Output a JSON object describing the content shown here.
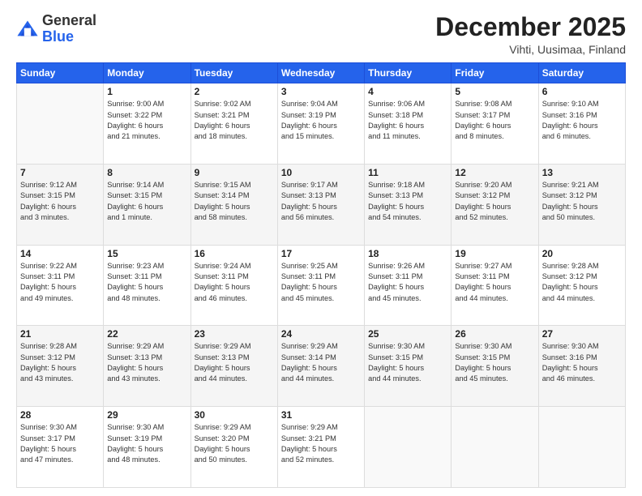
{
  "header": {
    "logo_general": "General",
    "logo_blue": "Blue",
    "month": "December 2025",
    "location": "Vihti, Uusimaa, Finland"
  },
  "days_of_week": [
    "Sunday",
    "Monday",
    "Tuesday",
    "Wednesday",
    "Thursday",
    "Friday",
    "Saturday"
  ],
  "weeks": [
    [
      {
        "day": "",
        "info": ""
      },
      {
        "day": "1",
        "info": "Sunrise: 9:00 AM\nSunset: 3:22 PM\nDaylight: 6 hours\nand 21 minutes."
      },
      {
        "day": "2",
        "info": "Sunrise: 9:02 AM\nSunset: 3:21 PM\nDaylight: 6 hours\nand 18 minutes."
      },
      {
        "day": "3",
        "info": "Sunrise: 9:04 AM\nSunset: 3:19 PM\nDaylight: 6 hours\nand 15 minutes."
      },
      {
        "day": "4",
        "info": "Sunrise: 9:06 AM\nSunset: 3:18 PM\nDaylight: 6 hours\nand 11 minutes."
      },
      {
        "day": "5",
        "info": "Sunrise: 9:08 AM\nSunset: 3:17 PM\nDaylight: 6 hours\nand 8 minutes."
      },
      {
        "day": "6",
        "info": "Sunrise: 9:10 AM\nSunset: 3:16 PM\nDaylight: 6 hours\nand 6 minutes."
      }
    ],
    [
      {
        "day": "7",
        "info": "Sunrise: 9:12 AM\nSunset: 3:15 PM\nDaylight: 6 hours\nand 3 minutes."
      },
      {
        "day": "8",
        "info": "Sunrise: 9:14 AM\nSunset: 3:15 PM\nDaylight: 6 hours\nand 1 minute."
      },
      {
        "day": "9",
        "info": "Sunrise: 9:15 AM\nSunset: 3:14 PM\nDaylight: 5 hours\nand 58 minutes."
      },
      {
        "day": "10",
        "info": "Sunrise: 9:17 AM\nSunset: 3:13 PM\nDaylight: 5 hours\nand 56 minutes."
      },
      {
        "day": "11",
        "info": "Sunrise: 9:18 AM\nSunset: 3:13 PM\nDaylight: 5 hours\nand 54 minutes."
      },
      {
        "day": "12",
        "info": "Sunrise: 9:20 AM\nSunset: 3:12 PM\nDaylight: 5 hours\nand 52 minutes."
      },
      {
        "day": "13",
        "info": "Sunrise: 9:21 AM\nSunset: 3:12 PM\nDaylight: 5 hours\nand 50 minutes."
      }
    ],
    [
      {
        "day": "14",
        "info": "Sunrise: 9:22 AM\nSunset: 3:11 PM\nDaylight: 5 hours\nand 49 minutes."
      },
      {
        "day": "15",
        "info": "Sunrise: 9:23 AM\nSunset: 3:11 PM\nDaylight: 5 hours\nand 48 minutes."
      },
      {
        "day": "16",
        "info": "Sunrise: 9:24 AM\nSunset: 3:11 PM\nDaylight: 5 hours\nand 46 minutes."
      },
      {
        "day": "17",
        "info": "Sunrise: 9:25 AM\nSunset: 3:11 PM\nDaylight: 5 hours\nand 45 minutes."
      },
      {
        "day": "18",
        "info": "Sunrise: 9:26 AM\nSunset: 3:11 PM\nDaylight: 5 hours\nand 45 minutes."
      },
      {
        "day": "19",
        "info": "Sunrise: 9:27 AM\nSunset: 3:11 PM\nDaylight: 5 hours\nand 44 minutes."
      },
      {
        "day": "20",
        "info": "Sunrise: 9:28 AM\nSunset: 3:12 PM\nDaylight: 5 hours\nand 44 minutes."
      }
    ],
    [
      {
        "day": "21",
        "info": "Sunrise: 9:28 AM\nSunset: 3:12 PM\nDaylight: 5 hours\nand 43 minutes."
      },
      {
        "day": "22",
        "info": "Sunrise: 9:29 AM\nSunset: 3:13 PM\nDaylight: 5 hours\nand 43 minutes."
      },
      {
        "day": "23",
        "info": "Sunrise: 9:29 AM\nSunset: 3:13 PM\nDaylight: 5 hours\nand 44 minutes."
      },
      {
        "day": "24",
        "info": "Sunrise: 9:29 AM\nSunset: 3:14 PM\nDaylight: 5 hours\nand 44 minutes."
      },
      {
        "day": "25",
        "info": "Sunrise: 9:30 AM\nSunset: 3:15 PM\nDaylight: 5 hours\nand 44 minutes."
      },
      {
        "day": "26",
        "info": "Sunrise: 9:30 AM\nSunset: 3:15 PM\nDaylight: 5 hours\nand 45 minutes."
      },
      {
        "day": "27",
        "info": "Sunrise: 9:30 AM\nSunset: 3:16 PM\nDaylight: 5 hours\nand 46 minutes."
      }
    ],
    [
      {
        "day": "28",
        "info": "Sunrise: 9:30 AM\nSunset: 3:17 PM\nDaylight: 5 hours\nand 47 minutes."
      },
      {
        "day": "29",
        "info": "Sunrise: 9:30 AM\nSunset: 3:19 PM\nDaylight: 5 hours\nand 48 minutes."
      },
      {
        "day": "30",
        "info": "Sunrise: 9:29 AM\nSunset: 3:20 PM\nDaylight: 5 hours\nand 50 minutes."
      },
      {
        "day": "31",
        "info": "Sunrise: 9:29 AM\nSunset: 3:21 PM\nDaylight: 5 hours\nand 52 minutes."
      },
      {
        "day": "",
        "info": ""
      },
      {
        "day": "",
        "info": ""
      },
      {
        "day": "",
        "info": ""
      }
    ]
  ]
}
